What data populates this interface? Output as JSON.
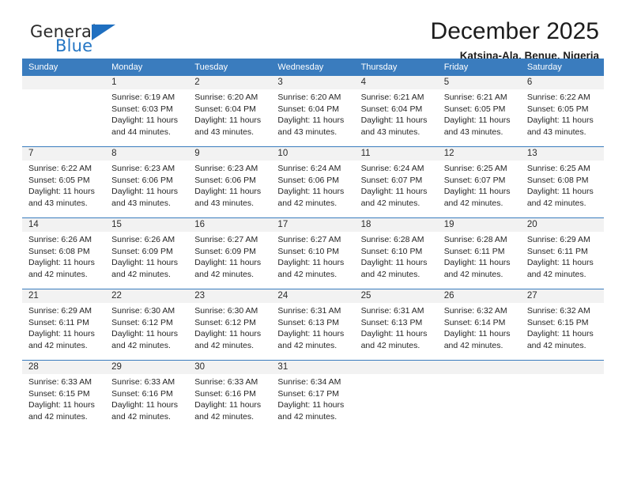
{
  "brand": {
    "name_part1": "General",
    "name_part2": "Blue",
    "logo_icon": "triangle-logo-icon",
    "accent_color": "#1f6fc0"
  },
  "header": {
    "title": "December 2025",
    "subtitle": "Katsina-Ala, Benue, Nigeria"
  },
  "calendar": {
    "header_bg": "#3a7cbe",
    "daynum_bg": "#f2f2f2",
    "weekdays": [
      "Sunday",
      "Monday",
      "Tuesday",
      "Wednesday",
      "Thursday",
      "Friday",
      "Saturday"
    ],
    "weeks": [
      [
        {
          "day": "",
          "lines": []
        },
        {
          "day": "1",
          "lines": [
            "Sunrise: 6:19 AM",
            "Sunset: 6:03 PM",
            "Daylight: 11 hours",
            "and 44 minutes."
          ]
        },
        {
          "day": "2",
          "lines": [
            "Sunrise: 6:20 AM",
            "Sunset: 6:04 PM",
            "Daylight: 11 hours",
            "and 43 minutes."
          ]
        },
        {
          "day": "3",
          "lines": [
            "Sunrise: 6:20 AM",
            "Sunset: 6:04 PM",
            "Daylight: 11 hours",
            "and 43 minutes."
          ]
        },
        {
          "day": "4",
          "lines": [
            "Sunrise: 6:21 AM",
            "Sunset: 6:04 PM",
            "Daylight: 11 hours",
            "and 43 minutes."
          ]
        },
        {
          "day": "5",
          "lines": [
            "Sunrise: 6:21 AM",
            "Sunset: 6:05 PM",
            "Daylight: 11 hours",
            "and 43 minutes."
          ]
        },
        {
          "day": "6",
          "lines": [
            "Sunrise: 6:22 AM",
            "Sunset: 6:05 PM",
            "Daylight: 11 hours",
            "and 43 minutes."
          ]
        }
      ],
      [
        {
          "day": "7",
          "lines": [
            "Sunrise: 6:22 AM",
            "Sunset: 6:05 PM",
            "Daylight: 11 hours",
            "and 43 minutes."
          ]
        },
        {
          "day": "8",
          "lines": [
            "Sunrise: 6:23 AM",
            "Sunset: 6:06 PM",
            "Daylight: 11 hours",
            "and 43 minutes."
          ]
        },
        {
          "day": "9",
          "lines": [
            "Sunrise: 6:23 AM",
            "Sunset: 6:06 PM",
            "Daylight: 11 hours",
            "and 43 minutes."
          ]
        },
        {
          "day": "10",
          "lines": [
            "Sunrise: 6:24 AM",
            "Sunset: 6:06 PM",
            "Daylight: 11 hours",
            "and 42 minutes."
          ]
        },
        {
          "day": "11",
          "lines": [
            "Sunrise: 6:24 AM",
            "Sunset: 6:07 PM",
            "Daylight: 11 hours",
            "and 42 minutes."
          ]
        },
        {
          "day": "12",
          "lines": [
            "Sunrise: 6:25 AM",
            "Sunset: 6:07 PM",
            "Daylight: 11 hours",
            "and 42 minutes."
          ]
        },
        {
          "day": "13",
          "lines": [
            "Sunrise: 6:25 AM",
            "Sunset: 6:08 PM",
            "Daylight: 11 hours",
            "and 42 minutes."
          ]
        }
      ],
      [
        {
          "day": "14",
          "lines": [
            "Sunrise: 6:26 AM",
            "Sunset: 6:08 PM",
            "Daylight: 11 hours",
            "and 42 minutes."
          ]
        },
        {
          "day": "15",
          "lines": [
            "Sunrise: 6:26 AM",
            "Sunset: 6:09 PM",
            "Daylight: 11 hours",
            "and 42 minutes."
          ]
        },
        {
          "day": "16",
          "lines": [
            "Sunrise: 6:27 AM",
            "Sunset: 6:09 PM",
            "Daylight: 11 hours",
            "and 42 minutes."
          ]
        },
        {
          "day": "17",
          "lines": [
            "Sunrise: 6:27 AM",
            "Sunset: 6:10 PM",
            "Daylight: 11 hours",
            "and 42 minutes."
          ]
        },
        {
          "day": "18",
          "lines": [
            "Sunrise: 6:28 AM",
            "Sunset: 6:10 PM",
            "Daylight: 11 hours",
            "and 42 minutes."
          ]
        },
        {
          "day": "19",
          "lines": [
            "Sunrise: 6:28 AM",
            "Sunset: 6:11 PM",
            "Daylight: 11 hours",
            "and 42 minutes."
          ]
        },
        {
          "day": "20",
          "lines": [
            "Sunrise: 6:29 AM",
            "Sunset: 6:11 PM",
            "Daylight: 11 hours",
            "and 42 minutes."
          ]
        }
      ],
      [
        {
          "day": "21",
          "lines": [
            "Sunrise: 6:29 AM",
            "Sunset: 6:11 PM",
            "Daylight: 11 hours",
            "and 42 minutes."
          ]
        },
        {
          "day": "22",
          "lines": [
            "Sunrise: 6:30 AM",
            "Sunset: 6:12 PM",
            "Daylight: 11 hours",
            "and 42 minutes."
          ]
        },
        {
          "day": "23",
          "lines": [
            "Sunrise: 6:30 AM",
            "Sunset: 6:12 PM",
            "Daylight: 11 hours",
            "and 42 minutes."
          ]
        },
        {
          "day": "24",
          "lines": [
            "Sunrise: 6:31 AM",
            "Sunset: 6:13 PM",
            "Daylight: 11 hours",
            "and 42 minutes."
          ]
        },
        {
          "day": "25",
          "lines": [
            "Sunrise: 6:31 AM",
            "Sunset: 6:13 PM",
            "Daylight: 11 hours",
            "and 42 minutes."
          ]
        },
        {
          "day": "26",
          "lines": [
            "Sunrise: 6:32 AM",
            "Sunset: 6:14 PM",
            "Daylight: 11 hours",
            "and 42 minutes."
          ]
        },
        {
          "day": "27",
          "lines": [
            "Sunrise: 6:32 AM",
            "Sunset: 6:15 PM",
            "Daylight: 11 hours",
            "and 42 minutes."
          ]
        }
      ],
      [
        {
          "day": "28",
          "lines": [
            "Sunrise: 6:33 AM",
            "Sunset: 6:15 PM",
            "Daylight: 11 hours",
            "and 42 minutes."
          ]
        },
        {
          "day": "29",
          "lines": [
            "Sunrise: 6:33 AM",
            "Sunset: 6:16 PM",
            "Daylight: 11 hours",
            "and 42 minutes."
          ]
        },
        {
          "day": "30",
          "lines": [
            "Sunrise: 6:33 AM",
            "Sunset: 6:16 PM",
            "Daylight: 11 hours",
            "and 42 minutes."
          ]
        },
        {
          "day": "31",
          "lines": [
            "Sunrise: 6:34 AM",
            "Sunset: 6:17 PM",
            "Daylight: 11 hours",
            "and 42 minutes."
          ]
        },
        {
          "day": "",
          "lines": []
        },
        {
          "day": "",
          "lines": []
        },
        {
          "day": "",
          "lines": []
        }
      ]
    ]
  }
}
